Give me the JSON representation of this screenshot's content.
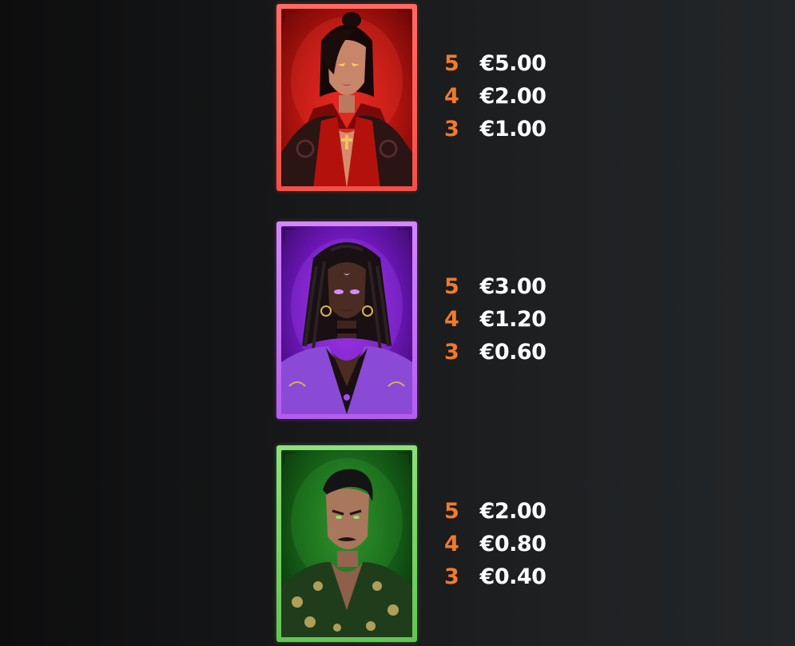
{
  "symbols": [
    {
      "id": "red-vampire",
      "portrait_icon": "red-vampire-woman-portrait",
      "frame_color": "#f25048",
      "payouts": [
        {
          "count": "5",
          "value": "€5.00"
        },
        {
          "count": "4",
          "value": "€2.00"
        },
        {
          "count": "3",
          "value": "€1.00"
        }
      ]
    },
    {
      "id": "purple-witch",
      "portrait_icon": "purple-witch-woman-portrait",
      "frame_color": "#b45cf0",
      "payouts": [
        {
          "count": "5",
          "value": "€3.00"
        },
        {
          "count": "4",
          "value": "€1.20"
        },
        {
          "count": "3",
          "value": "€0.60"
        }
      ]
    },
    {
      "id": "green-gangster",
      "portrait_icon": "green-gangster-man-portrait",
      "frame_color": "#62c453",
      "payouts": [
        {
          "count": "5",
          "value": "€2.00"
        },
        {
          "count": "4",
          "value": "€0.80"
        },
        {
          "count": "3",
          "value": "€0.40"
        }
      ]
    }
  ],
  "colors": {
    "count_accent": "#f07a2e",
    "value_text": "#ffffff"
  }
}
